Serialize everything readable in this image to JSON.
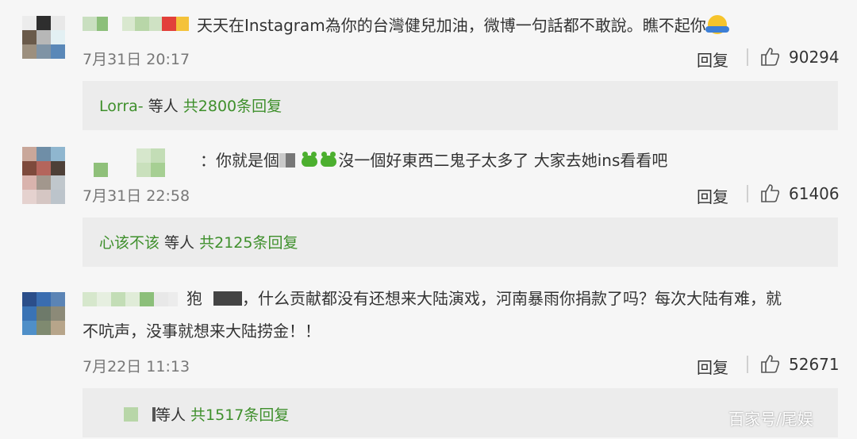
{
  "comments": [
    {
      "text": "天天在Instagram為你的台灣健兒加油，微博一句話都不敢說。瞧不起你",
      "time": "7月31日 20:17",
      "reply_label": "回复",
      "likes": "90294",
      "sub_user": "Lorra-",
      "sub_mid": " 等人 ",
      "sub_count": "共2800条回复"
    },
    {
      "text_a": "：你就是個",
      "text_b": "沒一個好東西二鬼子太多了 大家去她ins看看吧",
      "time": "7月31日 22:58",
      "reply_label": "回复",
      "likes": "61406",
      "sub_user": "心该不该",
      "sub_mid": " 等人 ",
      "sub_count": "共2125条回复"
    },
    {
      "text_a": "狍",
      "text_b": "，什么贡献都没有还想来大陆演戏，河南暴雨你捐款了吗？每次大陆有难，就",
      "text_c": "不吭声，没事就想来大陆捞金！！",
      "time": "7月22日 11:13",
      "reply_label": "回复",
      "likes": "52671",
      "sub_mid": "等人 ",
      "sub_count": "共1517条回复"
    }
  ],
  "watermark": "百家号/尾娱",
  "icons": {
    "like": "thumbs-up-icon",
    "emoji": "hug-emoji-icon",
    "frog": "frog-emoji-icon"
  }
}
